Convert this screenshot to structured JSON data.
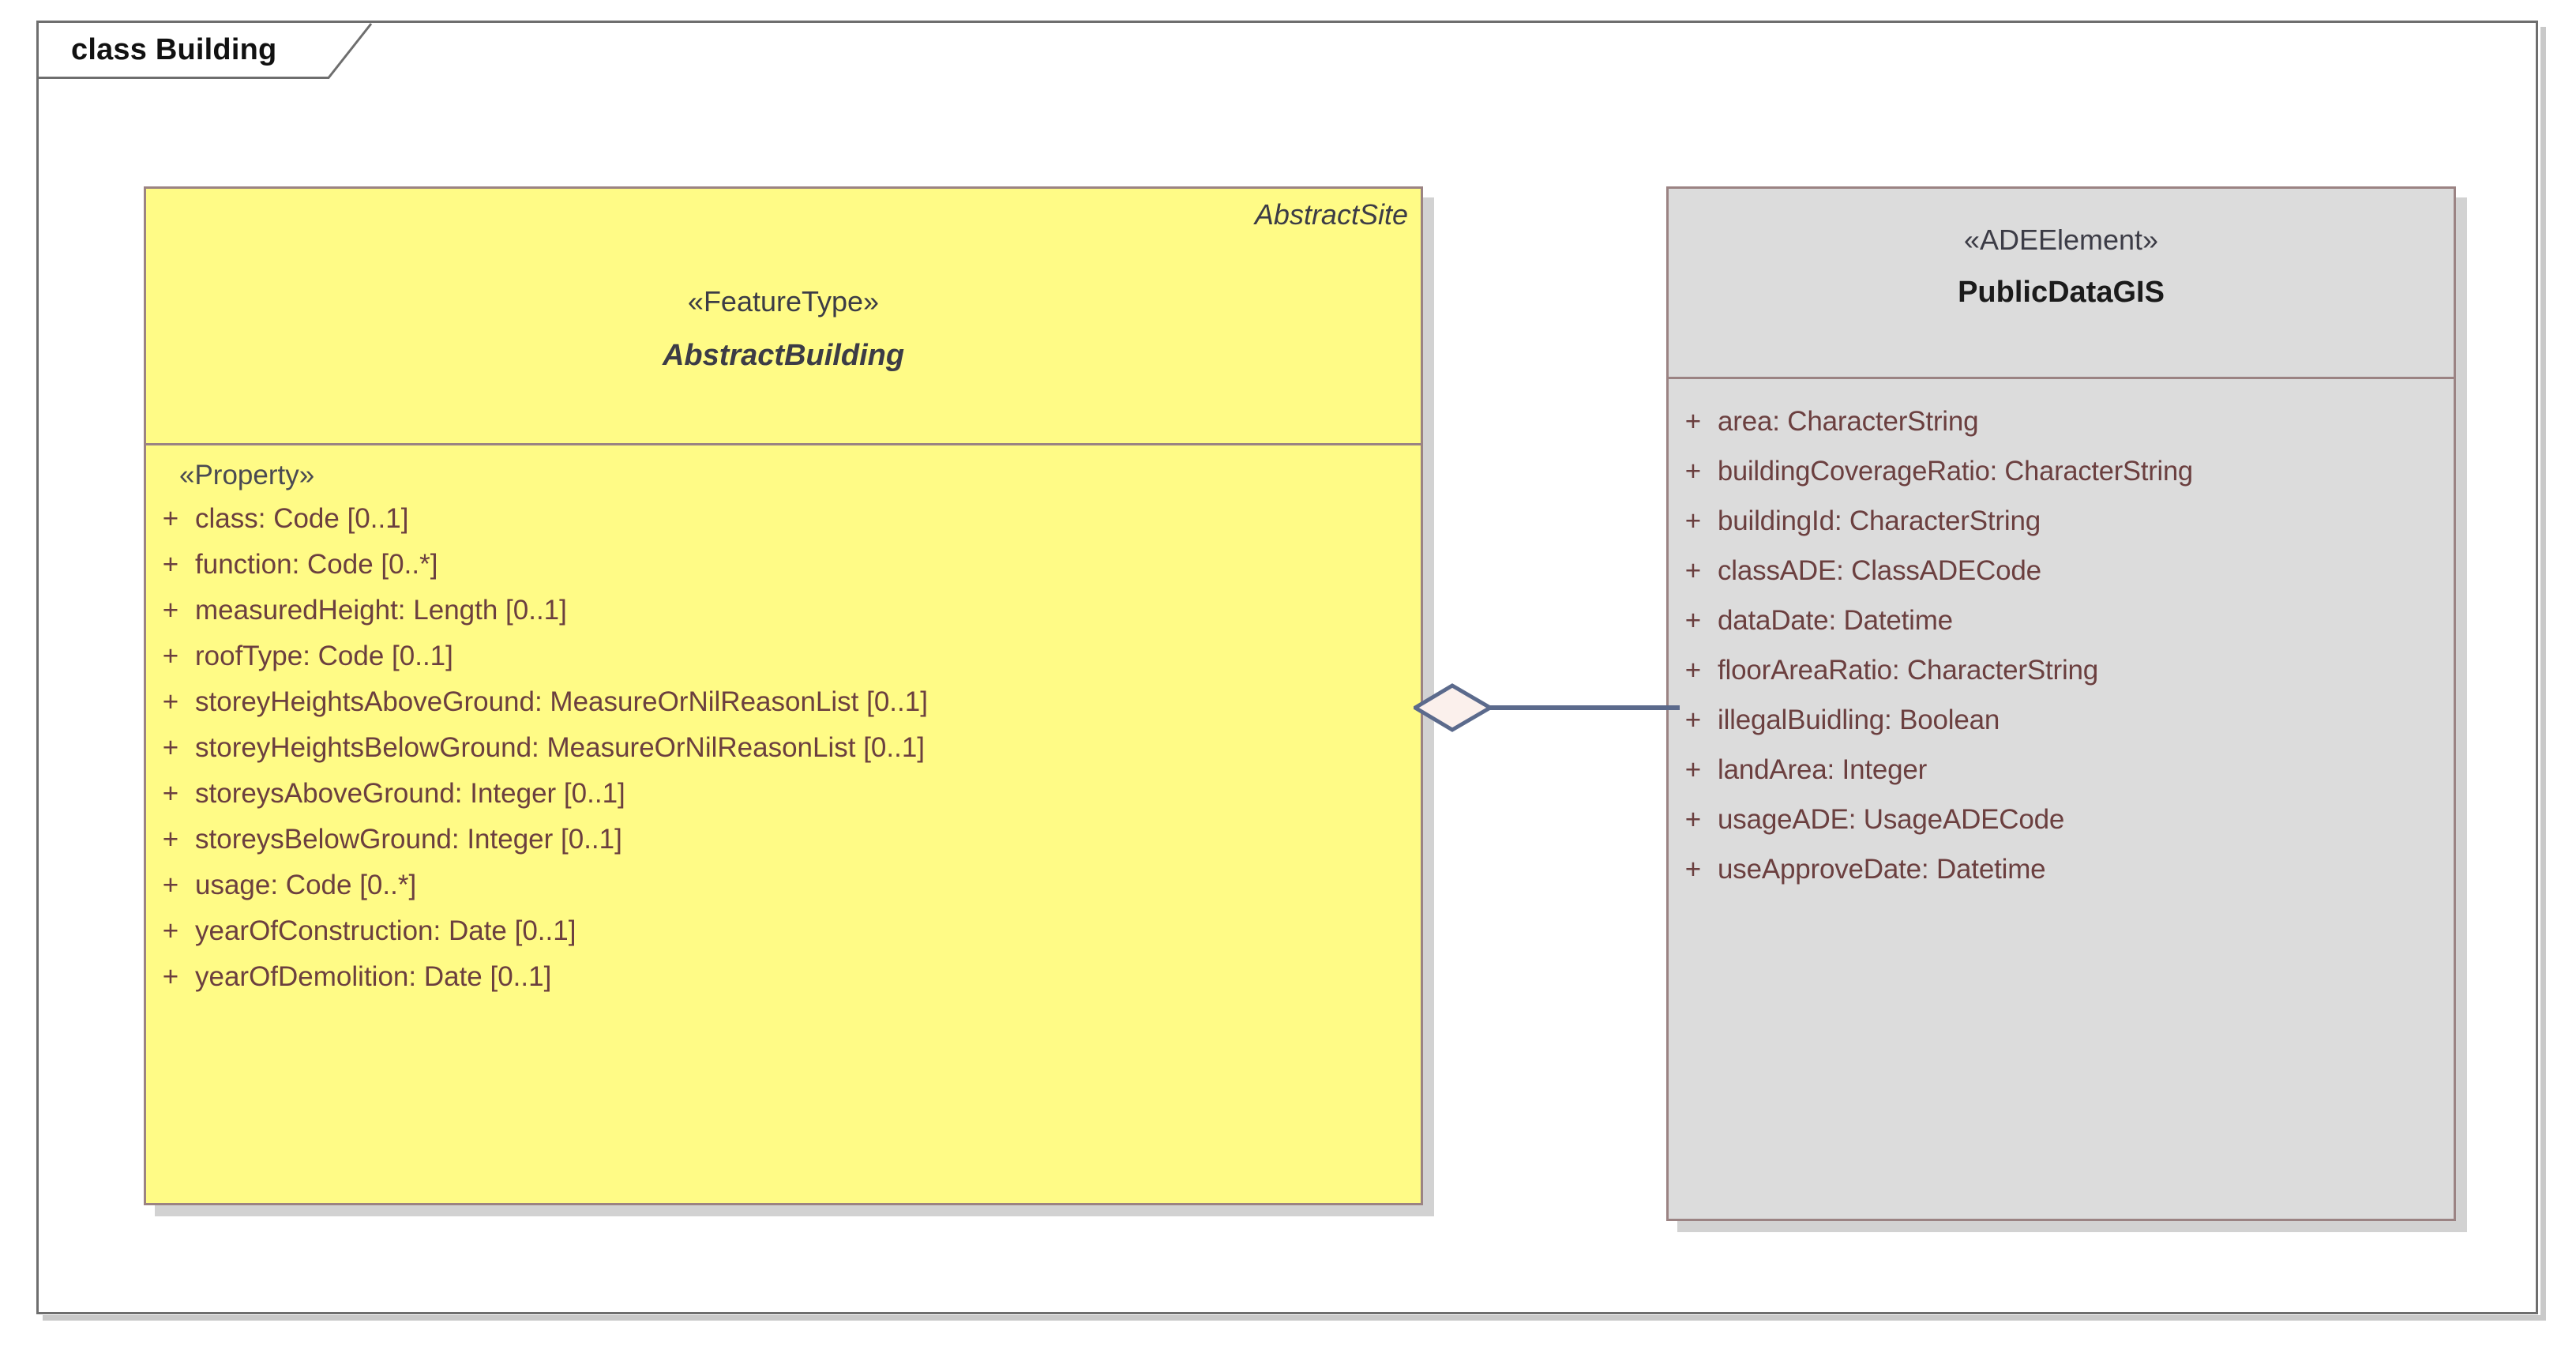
{
  "frame": {
    "title": "class Building",
    "border_color": "#6e6e6e"
  },
  "colors": {
    "yellow_fill": "#fffb86",
    "grey_fill": "#dcdcdc",
    "box_border": "#9b8383",
    "attribute_text": "#6b3f3f",
    "connector_line": "#5b6a8c",
    "diamond_fill": "#fbf0ec",
    "shadow": "#d2d2d2"
  },
  "classes": [
    {
      "id": "abstract-building",
      "corner_name": "AbstractSite",
      "stereotype": "«FeatureType»",
      "name": "AbstractBuilding",
      "abstract": true,
      "fill": "#fffb86",
      "attribute_group_stereotype": "«Property»",
      "attributes": [
        {
          "visibility": "+",
          "text": "class: Code [0..1]"
        },
        {
          "visibility": "+",
          "text": "function: Code [0..*]"
        },
        {
          "visibility": "+",
          "text": "measuredHeight: Length [0..1]"
        },
        {
          "visibility": "+",
          "text": "roofType: Code [0..1]"
        },
        {
          "visibility": "+",
          "text": "storeyHeightsAboveGround: MeasureOrNilReasonList [0..1]"
        },
        {
          "visibility": "+",
          "text": "storeyHeightsBelowGround: MeasureOrNilReasonList [0..1]"
        },
        {
          "visibility": "+",
          "text": "storeysAboveGround: Integer [0..1]"
        },
        {
          "visibility": "+",
          "text": "storeysBelowGround: Integer [0..1]"
        },
        {
          "visibility": "+",
          "text": "usage: Code [0..*]"
        },
        {
          "visibility": "+",
          "text": "yearOfConstruction: Date [0..1]"
        },
        {
          "visibility": "+",
          "text": "yearOfDemolition: Date [0..1]"
        }
      ]
    },
    {
      "id": "public-data-gis",
      "corner_name": "",
      "stereotype": "«ADEElement»",
      "name": "PublicDataGIS",
      "abstract": false,
      "fill": "#dcdcdc",
      "attribute_group_stereotype": "",
      "attributes": [
        {
          "visibility": "+",
          "text": "area: CharacterString"
        },
        {
          "visibility": "+",
          "text": "buildingCoverageRatio: CharacterString"
        },
        {
          "visibility": "+",
          "text": "buildingId: CharacterString"
        },
        {
          "visibility": "+",
          "text": "classADE: ClassADECode"
        },
        {
          "visibility": "+",
          "text": "dataDate: Datetime"
        },
        {
          "visibility": "+",
          "text": "floorAreaRatio: CharacterString"
        },
        {
          "visibility": "+",
          "text": "illegalBuidling: Boolean"
        },
        {
          "visibility": "+",
          "text": "landArea: Integer"
        },
        {
          "visibility": "+",
          "text": "usageADE: UsageADECode"
        },
        {
          "visibility": "+",
          "text": "useApproveDate: Datetime"
        }
      ]
    }
  ],
  "relationship": {
    "type": "aggregation",
    "source": "AbstractBuilding",
    "target": "PublicDataGIS",
    "diamond_end": "source"
  }
}
